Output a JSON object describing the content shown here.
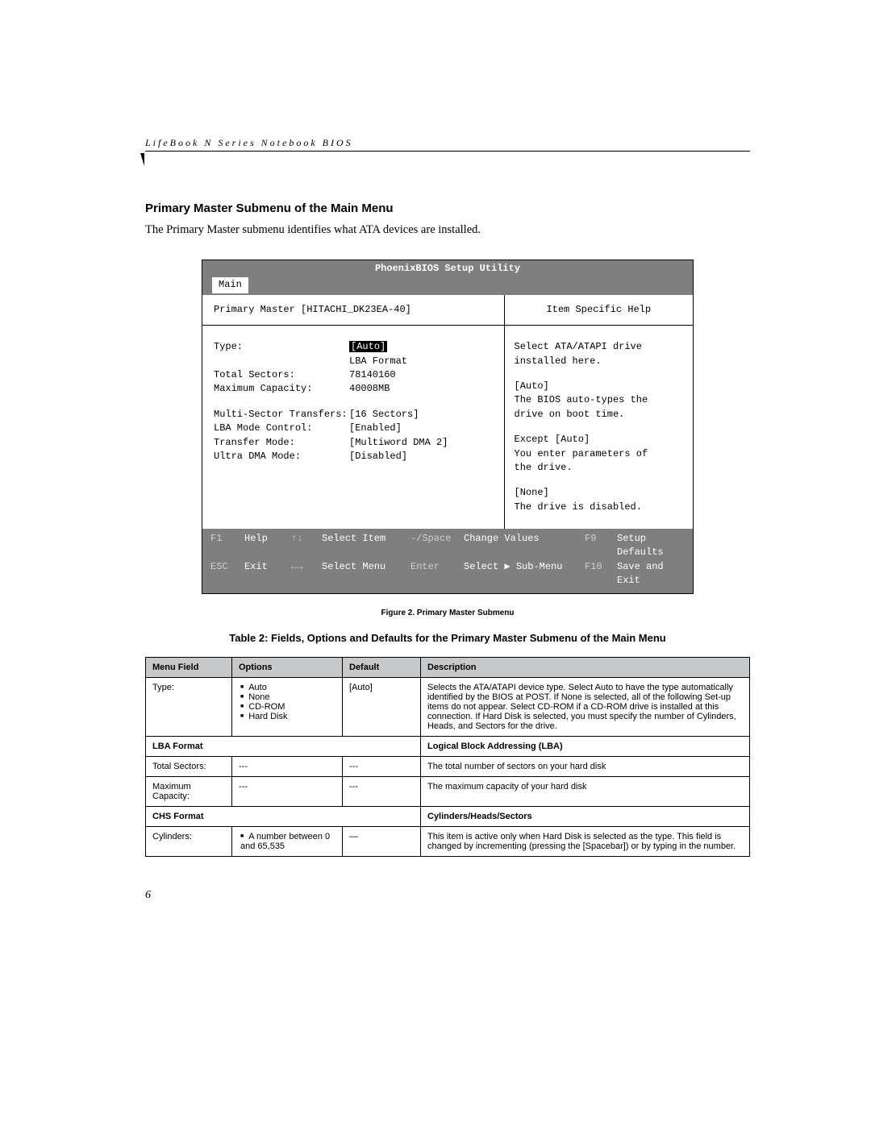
{
  "header": {
    "running_title": "LifeBook N Series Notebook BIOS"
  },
  "section": {
    "heading": "Primary Master Submenu of the Main Menu",
    "intro": "The Primary Master submenu identifies what ATA devices are installed."
  },
  "bios": {
    "title": "PhoenixBIOS Setup Utility",
    "menu_tab": "Main",
    "left_header": "Primary Master [HITACHI_DK23EA-40]",
    "right_header": "Item Specific Help",
    "fields": {
      "type_label": "Type:",
      "type_value": "[Auto]",
      "lba_label": "LBA Format",
      "sectors_label": "Total Sectors:",
      "sectors_value": "78140160",
      "maxcap_label": "Maximum Capacity:",
      "maxcap_value": "40008MB",
      "mst_label": "Multi-Sector Transfers:",
      "mst_value": "[16 Sectors]",
      "lbamode_label": "LBA Mode Control:",
      "lbamode_value": "[Enabled]",
      "transfer_label": "Transfer Mode:",
      "transfer_value": "[Multiword DMA 2]",
      "udma_label": "Ultra DMA Mode:",
      "udma_value": "[Disabled]"
    },
    "help": {
      "l1": "Select ATA/ATAPI drive",
      "l2": "installed here.",
      "l3": "[Auto]",
      "l4": "The BIOS auto-types the",
      "l5": "drive on boot time.",
      "l6": "Except [Auto]",
      "l7": "You enter parameters of",
      "l8": "the drive.",
      "l9": "[None]",
      "l10": "The drive is disabled."
    },
    "footer": {
      "f1": "F1",
      "help": "Help",
      "arrows_v": "↑↓",
      "select_item": "Select Item",
      "minus_space": "-/Space",
      "change_values": "Change Values",
      "f9": "F9",
      "setup_defaults": "Setup Defaults",
      "esc": "ESC",
      "exit": "Exit",
      "arrows_h": "←→",
      "select_menu": "Select Menu",
      "enter": "Enter",
      "select_sub": "Select ▶ Sub-Menu",
      "f10": "F10",
      "save_exit": "Save and Exit"
    }
  },
  "figure_caption": "Figure 2.  Primary Master Submenu",
  "table_caption": "Table 2: Fields, Options and Defaults for the Primary Master Submenu of the Main Menu",
  "table": {
    "headers": {
      "field": "Menu Field",
      "options": "Options",
      "default": "Default",
      "desc": "Description"
    },
    "rows": [
      {
        "field": "Type:",
        "options": [
          "Auto",
          "None",
          "CD-ROM",
          "Hard Disk"
        ],
        "default": "[Auto]",
        "desc": "Selects the ATA/ATAPI device type. Select Auto to have the type automatically identified by the BIOS at POST. If None is selected, all of the following Set-up items do not appear. Select CD-ROM if a CD-ROM drive is installed at this connection. If Hard Disk is selected, you must specify the number of Cylinders, Heads, and Sectors for the drive."
      },
      {
        "section": true,
        "field": "LBA Format",
        "desc": "Logical Block Addressing (LBA)"
      },
      {
        "field": "Total Sectors:",
        "options_text": "---",
        "default": "---",
        "desc": "The total number of sectors on your hard disk"
      },
      {
        "field": "Maximum Capacity:",
        "options_text": "---",
        "default": "---",
        "desc": "The maximum capacity of your hard disk"
      },
      {
        "section": true,
        "field": "CHS Format",
        "desc": "Cylinders/Heads/Sectors"
      },
      {
        "field": "Cylinders:",
        "options": [
          "A number between 0 and 65,535"
        ],
        "default": "—",
        "desc": "This item is active only when Hard Disk is selected as the type. This field is changed by incrementing (pressing the [Spacebar]) or by typing in the number."
      }
    ]
  },
  "page_number": "6"
}
